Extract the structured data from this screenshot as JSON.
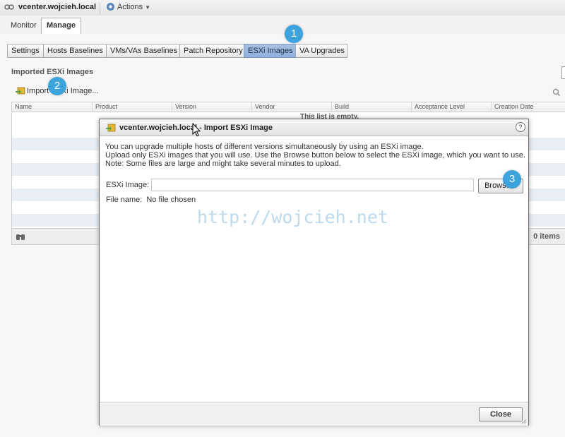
{
  "header": {
    "host": "vcenter.wojcieh.local",
    "actions_label": "Actions"
  },
  "tabs": [
    {
      "label": "Monitor"
    },
    {
      "label": "Manage"
    }
  ],
  "toolbar_buttons": [
    {
      "label": "Settings"
    },
    {
      "label": "Hosts Baselines"
    },
    {
      "label": "VMs/VAs Baselines"
    },
    {
      "label": "Patch Repository"
    },
    {
      "label": "ESXi Images"
    },
    {
      "label": "VA Upgrades"
    }
  ],
  "section": {
    "title": "Imported ESXi Images",
    "import_label": "Import ESXi Image..."
  },
  "grid": {
    "columns": [
      "Name",
      "Product",
      "Version",
      "Vendor",
      "Build",
      "Acceptance Level",
      "Creation Date"
    ],
    "empty_text": "This list is empty.",
    "items_count": "0 items"
  },
  "dialog": {
    "title": "vcenter.wojcieh.local - Import ESXi Image",
    "help": "?",
    "lines": [
      "You can upgrade multiple hosts of different versions simultaneously by using an ESXi image.",
      "Upload only ESXi images that you will use. Use the Browse button below to select the ESXi image, which you want to use.",
      "Note: Some files are large and might take several minutes to upload."
    ],
    "field_label": "ESXi Image:",
    "field_value": "",
    "browse_label": "Browse...",
    "file_name_label": "File name:",
    "file_name_value": "No file chosen",
    "close_label": "Close"
  },
  "watermark": "http://wojcieh.net",
  "callouts": [
    "1",
    "2",
    "3"
  ],
  "colors": {
    "active_tab": "#9bb8e0",
    "callout": "#3da3dc",
    "watermark": "#bcd9ee"
  }
}
